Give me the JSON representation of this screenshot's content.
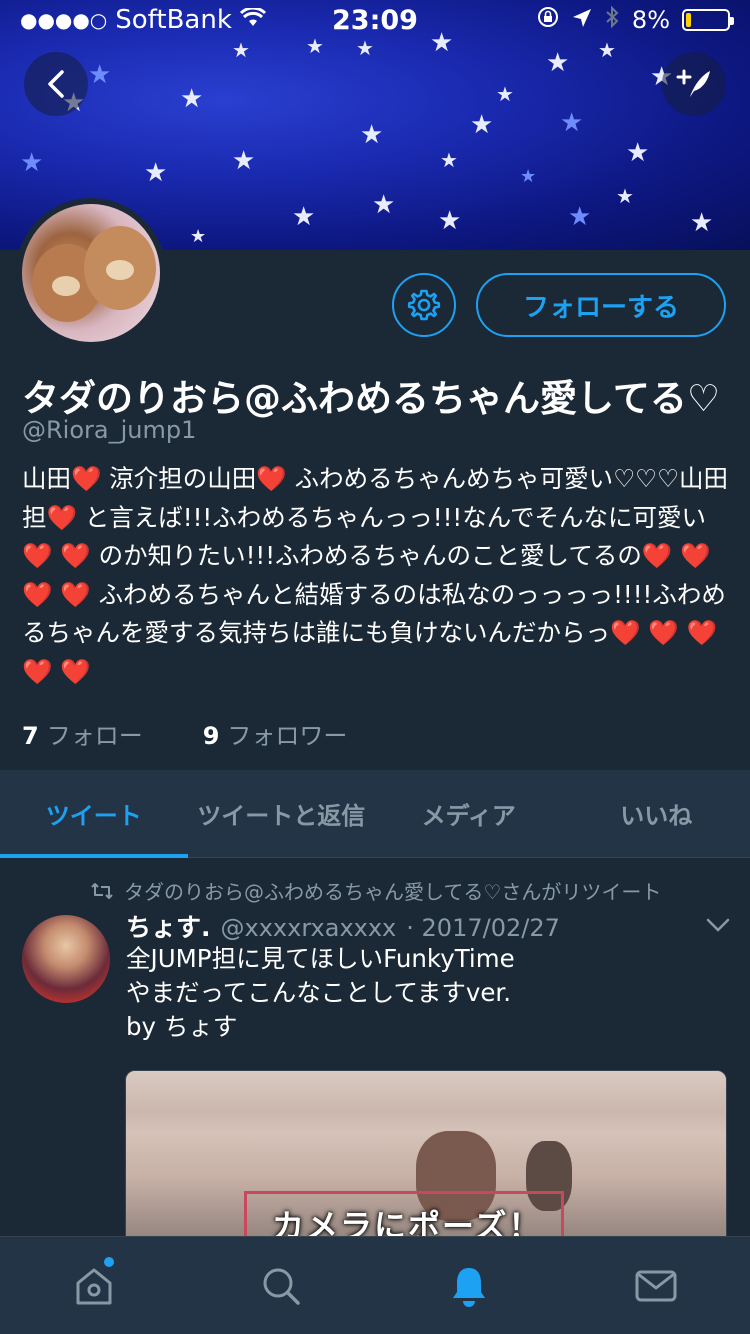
{
  "status_bar": {
    "signal": "●●●●○",
    "carrier": "SoftBank",
    "time": "23:09",
    "battery": "8%"
  },
  "profile": {
    "follow_label": "フォローする",
    "name": "タダのりおら@ふわめるちゃん愛してる♡",
    "handle": "@Riora_jump1",
    "bio": "山田❤️ 涼介担の山田❤️ ふわめるちゃんめちゃ可愛い♡♡♡山田担❤️ と言えば!!!ふわめるちゃんっっ!!!なんでそんなに可愛い❤️ ❤️ のか知りたい!!!ふわめるちゃんのこと愛してるの❤️ ❤️ ❤️ ❤️ ふわめるちゃんと結婚するのは私なのっっっっ!!!!ふわめるちゃんを愛する気持ちは誰にも負けないんだからっ❤️ ❤️ ❤️ ❤️ ❤️",
    "following_count": "7",
    "following_label": "フォロー",
    "followers_count": "9",
    "followers_label": "フォロワー"
  },
  "tabs": [
    {
      "label": "ツイート",
      "active": true
    },
    {
      "label": "ツイートと返信",
      "active": false
    },
    {
      "label": "メディア",
      "active": false
    },
    {
      "label": "いいね",
      "active": false
    }
  ],
  "tweet": {
    "retweet_text": "タダのりおら@ふわめるちゃん愛してる♡さんがリツイート",
    "author": "ちょす.",
    "username": "@xxxxrxaxxxx",
    "date": "· 2017/02/27",
    "text_line1": "全JUMP担に見てほしいFunkyTime",
    "text_line2": "やまだってこんなことしてますver.",
    "text_line3": "by ちょす",
    "media_caption": "カメラにポーズ！"
  },
  "colors": {
    "accent": "#1da1f2",
    "background": "#1b2836",
    "panel": "#243447",
    "secondary_text": "#8899a6",
    "battery_low": "#ffd200"
  },
  "icons": [
    "back-icon",
    "compose-icon",
    "gear-icon",
    "retweet-icon",
    "chevron-down-icon",
    "home-icon",
    "search-icon",
    "notifications-icon",
    "messages-icon",
    "wifi-icon",
    "location-icon",
    "bluetooth-icon",
    "lock-rotation-icon"
  ]
}
